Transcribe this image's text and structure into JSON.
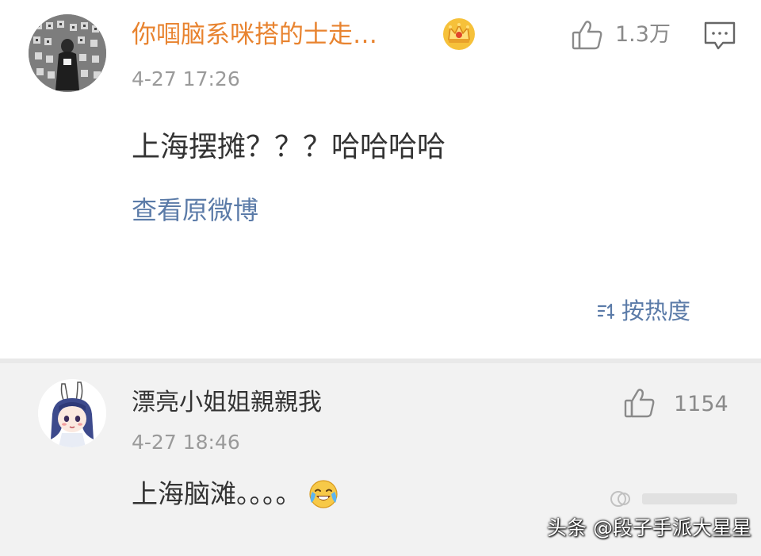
{
  "post": {
    "username": "你啯脑系咪搭的士走…",
    "badge_icon": "crown-icon",
    "time": "4-27 17:26",
    "like_icon": "thumbs-up-icon",
    "like_count": "1.3万",
    "comment_icon": "comment-icon",
    "content": "上海摆摊？？？哈哈哈哈",
    "view_original_label": "查看原微博",
    "avatar_icon": "avatar-image"
  },
  "sort": {
    "icon": "sort-icon",
    "label": "按热度"
  },
  "reply": {
    "username": "漂亮小姐姐親親我",
    "time": "4-27 18:46",
    "like_icon": "thumbs-up-icon",
    "like_count": "1154",
    "content": "上海脑滩。。。。",
    "emoji": "crying-laughing-emoji",
    "avatar_icon": "anime-avatar-image"
  },
  "watermark": {
    "text": "头条 @段子手派大星星"
  },
  "colors": {
    "username_orange": "#e8832f",
    "link_blue": "#5b7ba8",
    "meta_gray": "#9a9a9a",
    "reply_background": "#f2f2f2",
    "body_text": "#333333"
  }
}
